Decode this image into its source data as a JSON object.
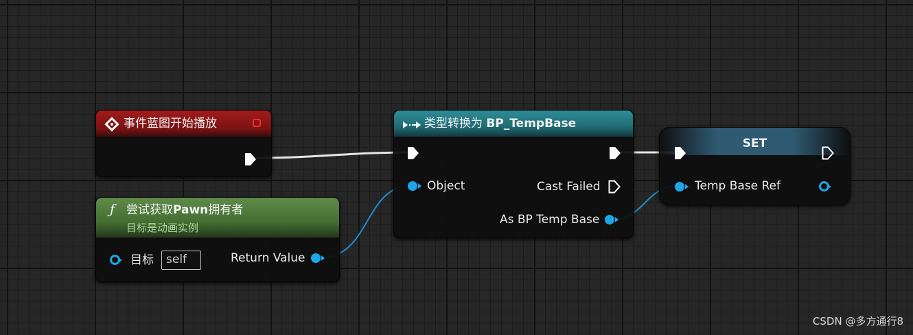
{
  "colors": {
    "exec_pin": "#ffffff",
    "object_pin": "#1fa6e8",
    "event_header": "#8e1717",
    "cast_header": "#2a7f8a",
    "function_header": "#4f7a3c",
    "set_header": "#30556a"
  },
  "nodes": {
    "event": {
      "icon": "event-diamond-icon",
      "title": "事件蓝图开始播放"
    },
    "function": {
      "icon": "function-f-icon",
      "icon_glyph": "ƒ",
      "title_prefix": "尝试获取",
      "title_bold": "Pawn",
      "title_suffix": "拥有者",
      "subtitle": "目标是动画实例",
      "target_label": "目标",
      "target_value": "self",
      "return_label": "Return Value"
    },
    "cast": {
      "icon": "cast-arrow-icon",
      "title_prefix": "类型转换为 ",
      "title_bold": "BP_TempBase",
      "object_label": "Object",
      "cast_failed_label": "Cast Failed",
      "as_label": "As BP Temp Base"
    },
    "set": {
      "title": "SET",
      "var_label": "Temp Base Ref"
    }
  },
  "watermark": "CSDN @多方通行8"
}
